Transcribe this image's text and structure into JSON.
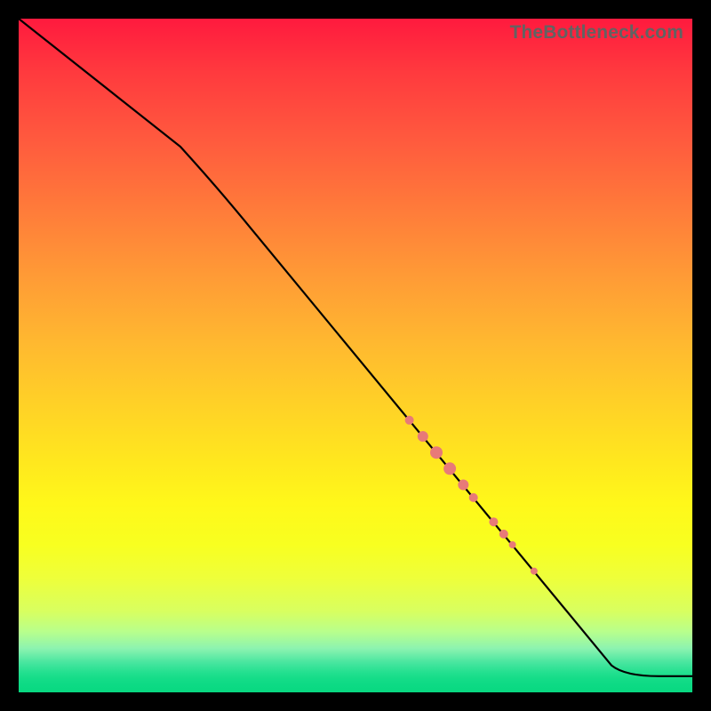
{
  "watermark": "TheBottleneck.com",
  "colors": {
    "line": "#000000",
    "dot": "#e87a78",
    "gradient_top": "#ff1a3e",
    "gradient_bottom": "#08d880",
    "frame": "#000000"
  },
  "chart_data": {
    "type": "line",
    "title": "",
    "xlabel": "",
    "ylabel": "",
    "xlim": [
      0,
      100
    ],
    "ylim": [
      0,
      100
    ],
    "grid": false,
    "line_points": [
      {
        "x": 0,
        "y": 100
      },
      {
        "x": 24,
        "y": 81
      },
      {
        "x": 29,
        "y": 75.5
      },
      {
        "x": 88,
        "y": 4
      },
      {
        "x": 90,
        "y": 2.4
      },
      {
        "x": 100,
        "y": 2.4
      }
    ],
    "highlighted_points": [
      {
        "x": 58.0,
        "y": 40.4,
        "r": 5
      },
      {
        "x": 60.0,
        "y": 38.0,
        "r": 6
      },
      {
        "x": 62.0,
        "y": 35.6,
        "r": 7
      },
      {
        "x": 64.0,
        "y": 33.2,
        "r": 7
      },
      {
        "x": 66.0,
        "y": 30.8,
        "r": 6
      },
      {
        "x": 67.5,
        "y": 28.9,
        "r": 5
      },
      {
        "x": 70.5,
        "y": 25.3,
        "r": 5
      },
      {
        "x": 72.0,
        "y": 23.5,
        "r": 5
      },
      {
        "x": 73.3,
        "y": 21.9,
        "r": 4
      },
      {
        "x": 76.5,
        "y": 18.0,
        "r": 4
      }
    ]
  }
}
